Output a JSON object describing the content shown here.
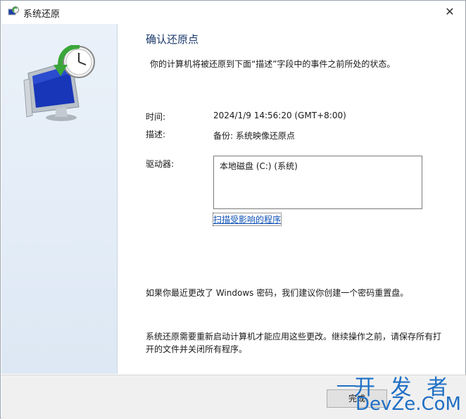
{
  "window": {
    "title": "系统还原",
    "close_glyph": "✕"
  },
  "content": {
    "heading": "确认还原点",
    "description": "你的计算机将被还原到下面“描述”字段中的事件之前所处的状态。",
    "time_label": "时间:",
    "time_value": "2024/1/9 14:56:20 (GMT+8:00)",
    "desc_label": "描述:",
    "desc_value": "备份: 系统映像还原点",
    "drive_label": "驱动器:",
    "drive_value": "本地磁盘 (C:) (系统)",
    "scan_link": "扫描受影响的程序",
    "password_note": "如果你最近更改了 Windows 密码，我们建议你创建一个密码重置盘。",
    "restart_note": "系统还原需要重新启动计算机才能应用这些更改。继续操作之前，请保存所有打开的文件并关闭所有程序。"
  },
  "footer": {
    "finish_label": "完成"
  },
  "watermark": {
    "top": "开 发 者",
    "bottom": "DevZe.CoM"
  },
  "icons": {
    "title_icon": "system-restore-icon",
    "sidebar_art": "restore-monitor-clock-icon"
  }
}
